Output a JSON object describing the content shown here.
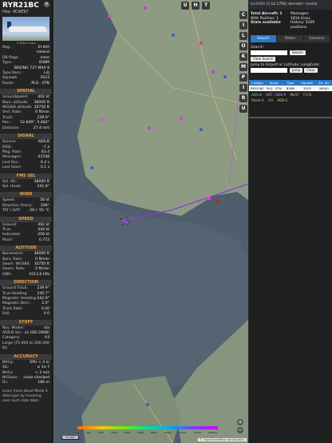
{
  "aircraft": {
    "callsign": "RYR21BC",
    "hex_label": "Hex:",
    "hex": "4CAE97",
    "photo_credit": "© Björn Hubo"
  },
  "info": [
    {
      "k": "Reg.:",
      "v": "EI-IHO"
    },
    {
      "k": "",
      "v": "Ireland"
    },
    {
      "k": "DB flags:",
      "v": "none"
    },
    {
      "k": "Type:",
      "v": "B38M"
    },
    {
      "k": "",
      "v": "BOEING 737 MAX 8"
    },
    {
      "k": "Type Desc.:",
      "v": "L2J"
    },
    {
      "k": "Squawk:",
      "v": "3523"
    },
    {
      "k": "Route:",
      "v": "PLQ - STN"
    }
  ],
  "sections": [
    {
      "title": "SPATIAL",
      "rows": [
        {
          "k": "Groundspeed:",
          "v": "402 kt"
        },
        {
          "k": "Baro. altitude:",
          "v": "36000 ft"
        },
        {
          "k": "WGS84 altitude:",
          "v": "35750 ft"
        },
        {
          "k": "Vert. Rate:",
          "v": "0 ft/min"
        },
        {
          "k": "Track:",
          "v": "239.9°"
        },
        {
          "k": "Pos.:",
          "v": "52.609°, 5.482°"
        },
        {
          "k": "Distance:",
          "v": "27.4 nmi"
        }
      ]
    },
    {
      "title": "SIGNAL",
      "rows": [
        {
          "k": "Source:",
          "v": "ADS-B"
        },
        {
          "k": "RSSI:",
          "v": "-7.3"
        },
        {
          "k": "Msg. Rate:",
          "v": "63.4"
        },
        {
          "k": "Messages:",
          "v": "43748"
        },
        {
          "k": "Last Pos.:",
          "v": "0.4 s"
        },
        {
          "k": "Last Seen:",
          "v": "0.1 s"
        }
      ]
    },
    {
      "title": "FMS SEL",
      "rows": [
        {
          "k": "Sel. Alt.:",
          "v": "36000 ft"
        },
        {
          "k": "Sel. Head.:",
          "v": "241.9°"
        }
      ]
    },
    {
      "title": "WIND",
      "rows": [
        {
          "k": "Speed:",
          "v": "56 kt"
        },
        {
          "k": "Direction (from):",
          "v": "290°"
        },
        {
          "k": "TAT / OAT:",
          "v": "-29 / -55 °C"
        }
      ]
    },
    {
      "title": "SPEED",
      "rows": [
        {
          "k": "Ground:",
          "v": "402 kt"
        },
        {
          "k": "True:",
          "v": "444 kt"
        },
        {
          "k": "Indicated:",
          "v": "256 kt"
        },
        {
          "k": "Mach:",
          "v": "0.772"
        }
      ]
    },
    {
      "title": "ALTITUDE",
      "rows": [
        {
          "k": "Barometric:",
          "v": "36000 ft"
        },
        {
          "k": "Baro. Rate:",
          "v": "0 ft/min"
        },
        {
          "k": "Geom. WGS84:",
          "v": "35750 ft"
        },
        {
          "k": "Geom. Rate:",
          "v": "0 ft/min"
        },
        {
          "k": "QNH:",
          "v": "1013.6 hPa"
        }
      ]
    },
    {
      "title": "DIRECTION",
      "rows": [
        {
          "k": "Ground Track:",
          "v": "239.9°"
        },
        {
          "k": "True Heading:",
          "v": "245.7°"
        },
        {
          "k": "Magnetic Heading:",
          "v": "242.9°"
        },
        {
          "k": "Magnetic Decl.:",
          "v": "2.9°"
        },
        {
          "k": "Track Rate:",
          "v": "0.00"
        },
        {
          "k": "Roll:",
          "v": "0.0"
        }
      ]
    },
    {
      "title": "STUFF",
      "rows": [
        {
          "k": "Nav. Modes:",
          "v": "n/a"
        },
        {
          "k": "ADS-B Ver.:",
          "v": "v2 (DO-260B)"
        },
        {
          "k": "Category:",
          "v": "A3"
        },
        {
          "k": "Large (75 000 to 300 000 lb)",
          "v": ""
        }
      ]
    },
    {
      "title": "ACCURACY",
      "rows": [
        {
          "k": "NACp:",
          "v": "EPU < 3 m"
        },
        {
          "k": "SIL:",
          "v": "≤ 1e-7"
        },
        {
          "k": "NACv:",
          "v": "< 3 m/s"
        },
        {
          "k": "NICbaro:",
          "v": "cross-checked"
        },
        {
          "k": "Rc:",
          "v": "186 m"
        }
      ]
    }
  ],
  "footer_note": "Learn more about Mode S data type by hovering over each data label.",
  "map": {
    "top_buttons": [
      "U",
      "H",
      "T"
    ],
    "side_buttons": [
      "C",
      "I",
      "L",
      "O",
      "K",
      "M",
      "P",
      "I",
      "R",
      "U"
    ],
    "scale_label": "5 nmi",
    "zoom_in": "+",
    "zoom_out": "−",
    "attribution": "© OpenStreetMap contributors.",
    "legend_labels": [
      "0",
      "500",
      "1000",
      "2000",
      "4000",
      "6000",
      "8000",
      "10000",
      "20000",
      "30000",
      "40000+"
    ],
    "colors": {
      "water": "#4c5a6a",
      "land": "#8d9b82",
      "track": "#8c3ad6"
    }
  },
  "right": {
    "header_link": "tar1090",
    "header_version": "(3.14.1792) decoder:",
    "header_link2": "readsb",
    "stats": {
      "total_label": "Total Aircraft: 1",
      "messages_label": "Messages:",
      "messages_rate": "1814.4/sec",
      "with_pos_label": "With Position: 1",
      "history_label": "History: 5209 positions",
      "stats_available": "Stats available"
    },
    "tabs": [
      "Search",
      "Filters",
      "Columns"
    ],
    "search_label": "Search:",
    "search_button": "Search",
    "clear_search": "Clear Search",
    "jump_label": "Jump to Airport or Latitude, Longitude:",
    "jump_button": "Jump",
    "clear_button": "Clear",
    "table_headers": [
      "Callsign",
      "Route",
      "Type",
      "Squawk",
      "Alt. (ft)"
    ],
    "table_row": [
      "RYR21BC",
      "PLQ - STN",
      "B38M",
      "3523",
      "36000"
    ],
    "badges": [
      {
        "label": "ADS-B",
        "color": "#7fd37f"
      },
      {
        "label": "UAT / ADS-R",
        "color": "#e0a0e0"
      },
      {
        "label": "MLAT",
        "color": "#e6c65a"
      },
      {
        "label": "TIS-B",
        "color": "#f08a8a"
      },
      {
        "label": "Mode-S",
        "color": "#bbbbbb"
      },
      {
        "label": "AIS",
        "color": "#aaaaaa"
      },
      {
        "label": "ADS-C",
        "color": "#cfe07a"
      }
    ]
  }
}
